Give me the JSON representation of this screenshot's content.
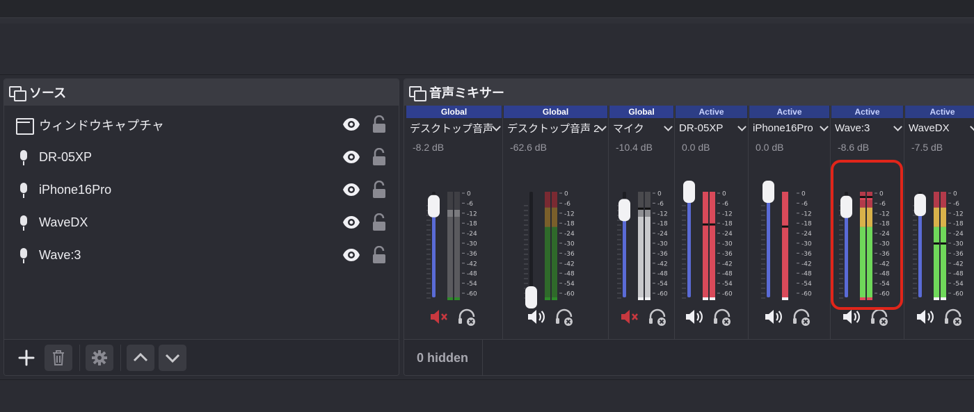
{
  "sources": {
    "title": "ソース",
    "items": [
      {
        "label": "ウィンドウキャプチャ",
        "icon": "window-capture-icon"
      },
      {
        "label": "DR-05XP",
        "icon": "microphone-icon"
      },
      {
        "label": "iPhone16Pro",
        "icon": "microphone-icon"
      },
      {
        "label": "WaveDX",
        "icon": "microphone-icon"
      },
      {
        "label": "Wave:3",
        "icon": "microphone-icon"
      }
    ],
    "toolbar": [
      "add-icon",
      "trash-icon",
      "gear-icon",
      "chevron-up-icon",
      "chevron-down-icon"
    ]
  },
  "mixer": {
    "title": "音声ミキサー",
    "hidden_label": "0 hidden",
    "scale_labels": [
      "0",
      "-6",
      "-12",
      "-18",
      "-24",
      "-30",
      "-36",
      "-42",
      "-48",
      "-54",
      "-60"
    ],
    "channels": [
      {
        "tag": "Global",
        "name": "デスクトップ音声",
        "db": "-8.2 dB",
        "fader_db": -8.2,
        "muted": true,
        "meter": "grey",
        "peak": 0.85
      },
      {
        "tag": "Global",
        "name": "デスクトップ音声 2",
        "db": "-62.6 dB",
        "fader_db": -62.6,
        "muted": false,
        "meter": "tri",
        "peak": 1.0
      },
      {
        "tag": "Global",
        "name": "マイク",
        "db": "-10.4 dB",
        "fader_db": -10.4,
        "muted": true,
        "meter": "white",
        "peak": 0.85
      },
      {
        "tag": "Active",
        "name": "DR-05XP",
        "db": "0.0 dB",
        "fader_db": 0.0,
        "muted": false,
        "meter": "red",
        "peak": 0.7
      },
      {
        "tag": "Active",
        "name": "iPhone16Pro",
        "db": "0.0 dB",
        "fader_db": 0.0,
        "muted": false,
        "meter": "red-single",
        "peak": 0.68
      },
      {
        "tag": "Active",
        "name": "Wave:3",
        "db": "-8.6 dB",
        "fader_db": -8.6,
        "muted": false,
        "meter": "tri-lit",
        "peak": 0.96,
        "highlighted": true
      },
      {
        "tag": "Active",
        "name": "WaveDX",
        "db": "-7.5 dB",
        "fader_db": -7.5,
        "muted": false,
        "meter": "tri-lit",
        "peak": 0.52
      }
    ]
  },
  "colors": {
    "fader_track": "#5a6bd6",
    "meter_red": "#d94a5a",
    "meter_green": "#6fd85a",
    "meter_yellow": "#d9b24a",
    "highlight": "#e0251a",
    "mute_red": "#c8383f"
  }
}
